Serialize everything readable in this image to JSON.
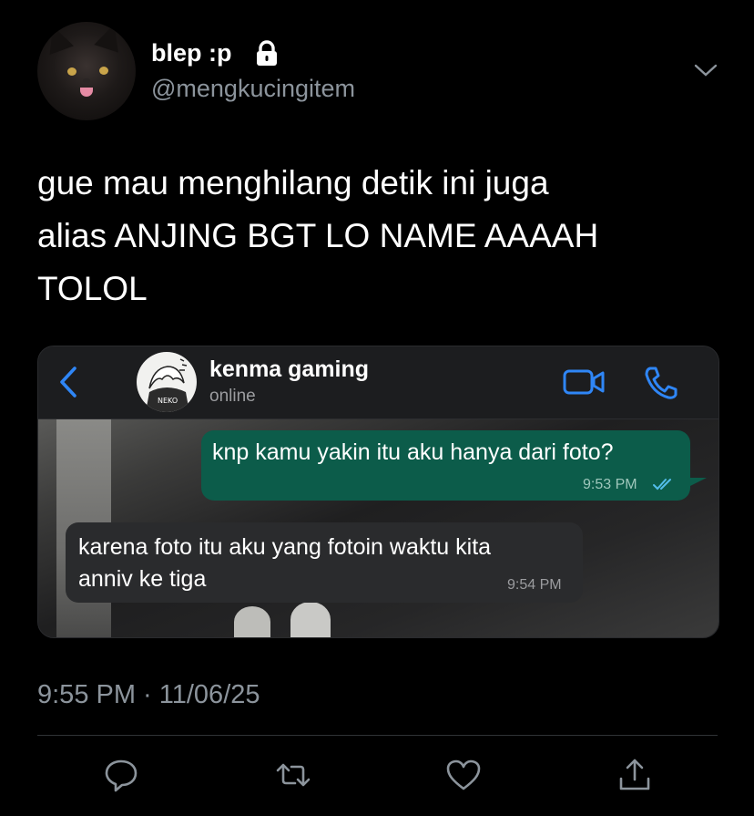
{
  "author": {
    "display_name": "blep :p",
    "handle": "@mengkucingitem",
    "avatar_icon": "black-cat-avatar",
    "locked_icon": "lock-icon"
  },
  "tweet": {
    "lines": [
      "gue mau menghilang detik ini juga",
      "alias ANJING BGT LO NAME AAAAH",
      "TOLOL"
    ],
    "timestamp": "9:55 PM · 11/06/25"
  },
  "media": {
    "chat": {
      "contact_name": "kenma gaming",
      "contact_status": "online",
      "messages": [
        {
          "direction": "outgoing",
          "text": "knp kamu yakin itu aku hanya dari foto?",
          "time": "9:53 PM",
          "read": true
        },
        {
          "direction": "incoming",
          "lines": [
            "karena foto itu aku yang fotoin waktu kita",
            "anniv ke tiga"
          ],
          "time": "9:54 PM"
        }
      ]
    }
  },
  "actions": [
    "reply-icon",
    "retweet-icon",
    "like-icon",
    "share-icon"
  ],
  "colors": {
    "background": "#000000",
    "secondary_text": "#8c949c",
    "outgoing_bubble": "#0c5c4a",
    "incoming_bubble": "#2a2b2d",
    "whatsapp_accent": "#2f86f6"
  }
}
